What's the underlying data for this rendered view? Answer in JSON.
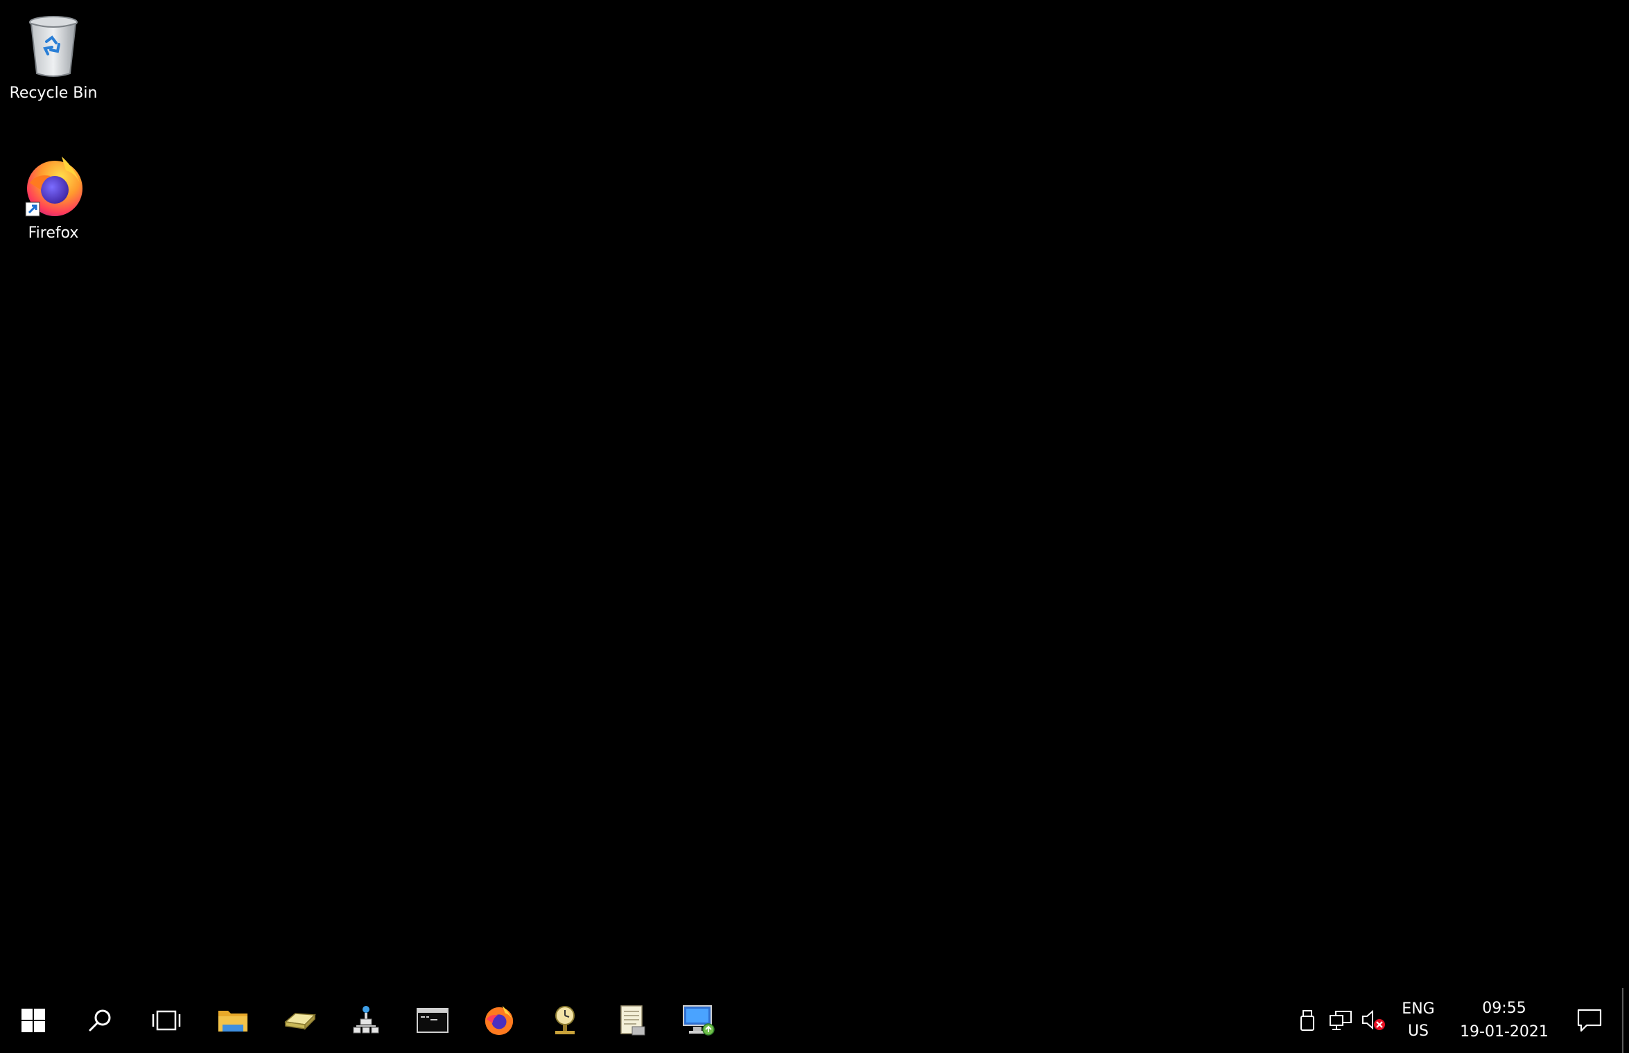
{
  "desktop": {
    "icons": [
      {
        "label": "Recycle Bin",
        "icon": "recycle-bin-icon"
      },
      {
        "label": "Firefox",
        "icon": "firefox-icon"
      }
    ]
  },
  "taskbar": {
    "start": {
      "icon": "windows-start-icon"
    },
    "search": {
      "icon": "search-icon"
    },
    "task_view": {
      "icon": "task-view-icon"
    },
    "pinned": [
      {
        "icon": "file-explorer-icon"
      },
      {
        "icon": "drive-tool-icon"
      },
      {
        "icon": "network-tool-icon"
      },
      {
        "icon": "command-prompt-icon"
      },
      {
        "icon": "firefox-icon"
      },
      {
        "icon": "scheduler-icon"
      },
      {
        "icon": "notepad-icon"
      },
      {
        "icon": "remote-desktop-icon"
      }
    ],
    "tray": {
      "usb_icon": "usb-icon",
      "network_icon": "network-icon",
      "volume_icon": "volume-muted-icon",
      "language_line1": "ENG",
      "language_line2": "US",
      "time": "09:55",
      "date": "19-01-2021",
      "notifications_icon": "notifications-icon"
    }
  },
  "colors": {
    "background": "#000000",
    "text": "#ffffff",
    "windows_blue": "#ffffff",
    "folder_yellow": "#f3c34a",
    "mute_red": "#e81123"
  }
}
